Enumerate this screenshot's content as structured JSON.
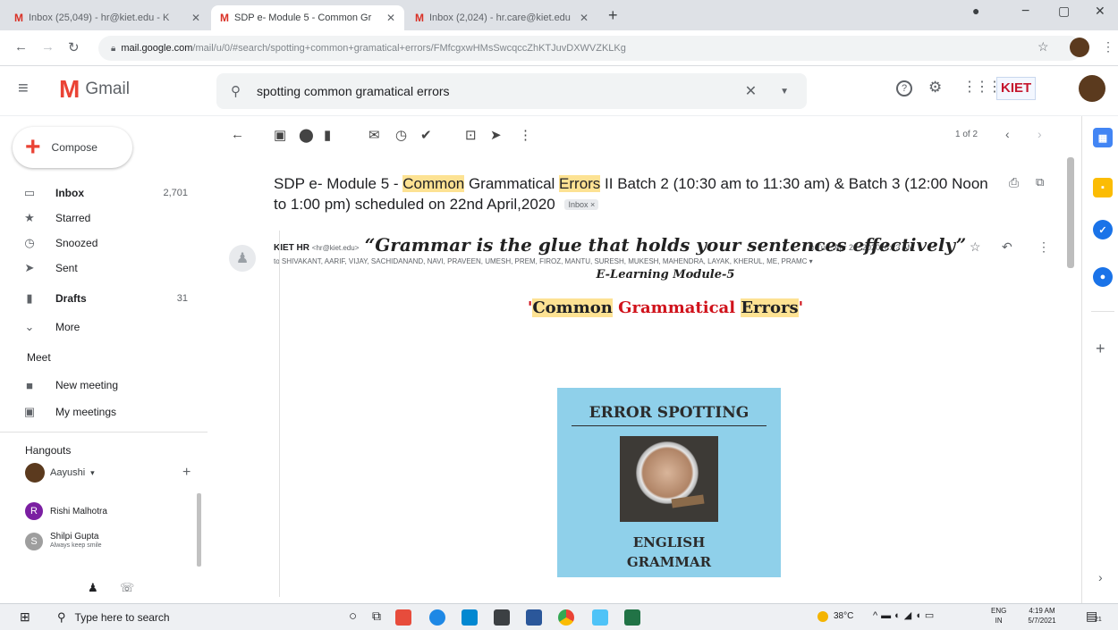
{
  "browser": {
    "tabs": [
      {
        "label": "Inbox (25,049) - hr@kiet.edu - K",
        "active": false
      },
      {
        "label": "SDP e- Module 5 - Common Gr",
        "active": true
      },
      {
        "label": "Inbox (2,024) - hr.care@kiet.edu",
        "active": false
      }
    ],
    "new_tab": "+",
    "url_host": "mail.google.com",
    "url_path": "/mail/u/0/#search/spotting+common+gramatical+errors/FMfcgxwHMsSwcqccZhKTJuvDXWVZKLKg"
  },
  "gmail": {
    "logo_text": "Gmail",
    "search_value": "spotting common gramatical errors",
    "compose_label": "Compose",
    "nav": [
      {
        "label": "Inbox",
        "count": "2,701",
        "bold": true,
        "icon": "inbox-icon"
      },
      {
        "label": "Starred",
        "count": "",
        "bold": false,
        "icon": "star-icon"
      },
      {
        "label": "Snoozed",
        "count": "",
        "bold": false,
        "icon": "clock-icon"
      },
      {
        "label": "Sent",
        "count": "",
        "bold": false,
        "icon": "send-icon"
      },
      {
        "label": "Drafts",
        "count": "31",
        "bold": true,
        "icon": "draft-icon"
      },
      {
        "label": "More",
        "count": "",
        "bold": false,
        "icon": "chevron-down-icon"
      }
    ],
    "meet": {
      "heading": "Meet",
      "new_meeting": "New meeting",
      "my_meetings": "My meetings"
    },
    "hangouts": {
      "heading": "Hangouts",
      "self": "Aayushi",
      "contacts": [
        {
          "name": "Rishi Malhotra",
          "status": "",
          "initial": "R"
        },
        {
          "name": "Shilpi Gupta",
          "status": "Always keep smile",
          "initial": "S"
        }
      ]
    },
    "pager": "1 of 2",
    "org_logo": "KIET"
  },
  "email": {
    "subject_pre": "SDP e- Module 5 - ",
    "subject_hl1": "Common",
    "subject_mid": " Grammatical ",
    "subject_hl2": "Errors",
    "subject_post": " II Batch 2 (10:30 am to 11:30 am) & Batch 3 (12:00 Noon to 1:00 pm) scheduled on 22nd April,2020",
    "label_chip": "Inbox ×",
    "sender_name": "KIET HR",
    "sender_email": "<hr@kiet.edu>",
    "date": "Tue, Apr 21, 2020, 8:23 AM",
    "recipients": "to SHIVAKANT, AARIF, VIJAY, SACHIDANAND, NAVI, PRAVEEN, UMESH, PREM, FIROZ, MANTU, SURESH, MUKESH, MAHENDRA, LAYAK, KHERUL, ME, PRAMC ▾",
    "quote": "“Grammar is the glue that holds your sentences effectively”",
    "module": "E-Learning Module-5",
    "title_q1": "'",
    "title_common": "Common",
    "title_grammatical": "Grammatical",
    "title_errors": "Errors",
    "title_q2": "'",
    "poster_top": "ERROR SPOTTING",
    "poster_bottom1": "ENGLISH",
    "poster_bottom2": "GRAMMAR"
  },
  "taskbar": {
    "search_placeholder": "Type here to search",
    "weather": "38°C",
    "lang1": "ENG",
    "lang2": "IN",
    "time": "4:19 AM",
    "date": "5/7/2021",
    "notif": "21"
  },
  "colors": {
    "gmail_red": "#ea4335",
    "highlight": "#fde293",
    "title_red": "#d0121b",
    "poster_bg": "#8fd0ea"
  }
}
